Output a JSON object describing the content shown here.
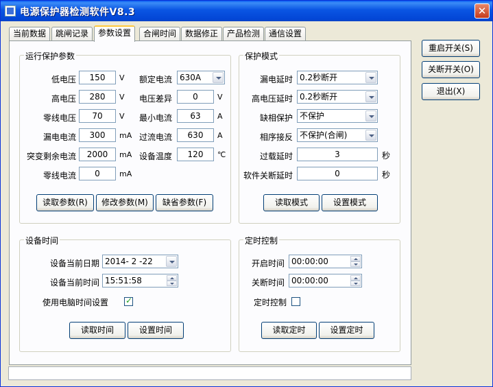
{
  "window": {
    "title": "电源保护器检测软件V8.3",
    "close_symbol": "✕"
  },
  "tabs": [
    "当前数据",
    "跳闸记录",
    "参数设置",
    "合闸时间",
    "数据修正",
    "产品检测",
    "通信设置"
  ],
  "run_params": {
    "title": "运行保护参数",
    "low_voltage": {
      "label": "低电压",
      "value": "150",
      "unit": "V"
    },
    "high_voltage": {
      "label": "高电压",
      "value": "280",
      "unit": "V"
    },
    "zero_voltage": {
      "label": "零线电压",
      "value": "70",
      "unit": "V"
    },
    "leak_current": {
      "label": "漏电电流",
      "value": "300",
      "unit": "mA"
    },
    "sudden_residual": {
      "label": "突变剩余电流",
      "value": "2000",
      "unit": "mA"
    },
    "zero_current": {
      "label": "零线电流",
      "value": "0",
      "unit": "mA"
    },
    "rated_current": {
      "label": "额定电流",
      "value": "630A"
    },
    "voltage_diff": {
      "label": "电压差异",
      "value": "0",
      "unit": "V"
    },
    "min_current": {
      "label": "最小电流",
      "value": "63",
      "unit": "A"
    },
    "over_current": {
      "label": "过流电流",
      "value": "630",
      "unit": "A"
    },
    "device_temp": {
      "label": "设备温度",
      "value": "120",
      "unit": "℃"
    },
    "btn_read": "读取参数(R)",
    "btn_modify": "修改参数(M)",
    "btn_default": "缺省参数(F)"
  },
  "protect_mode": {
    "title": "保护模式",
    "leak_delay": {
      "label": "漏电延时",
      "value": "0.2秒断开"
    },
    "hv_delay": {
      "label": "高电压延时",
      "value": "0.2秒断开"
    },
    "phase_loss": {
      "label": "缺相保护",
      "value": "不保护"
    },
    "phase_reverse": {
      "label": "相序接反",
      "value": "不保护(合闸)"
    },
    "overload_delay": {
      "label": "过载延时",
      "value": "3",
      "unit": "秒"
    },
    "soft_off_delay": {
      "label": "软件关断延时",
      "value": "0",
      "unit": "秒"
    },
    "btn_read": "读取模式",
    "btn_set": "设置模式"
  },
  "device_time": {
    "title": "设备时间",
    "date": {
      "label": "设备当前日期",
      "value": "2014- 2 -22"
    },
    "time": {
      "label": "设备当前时间",
      "value": "15:51:58"
    },
    "use_pc_time": {
      "label": "使用电脑时间设置",
      "checked": true
    },
    "btn_read": "读取时间",
    "btn_set": "设置时间"
  },
  "timer_control": {
    "title": "定时控制",
    "on_time": {
      "label": "开启时间",
      "value": "00:00:00"
    },
    "off_time": {
      "label": "关断时间",
      "value": "00:00:00"
    },
    "enable": {
      "label": "定时控制",
      "checked": false
    },
    "btn_read": "读取定时",
    "btn_set": "设置定时"
  },
  "side_buttons": {
    "restart": "重启开关(S)",
    "shutdown": "关断开关(O)",
    "exit": "退出(X)"
  },
  "statusbar": {
    "text": ""
  }
}
